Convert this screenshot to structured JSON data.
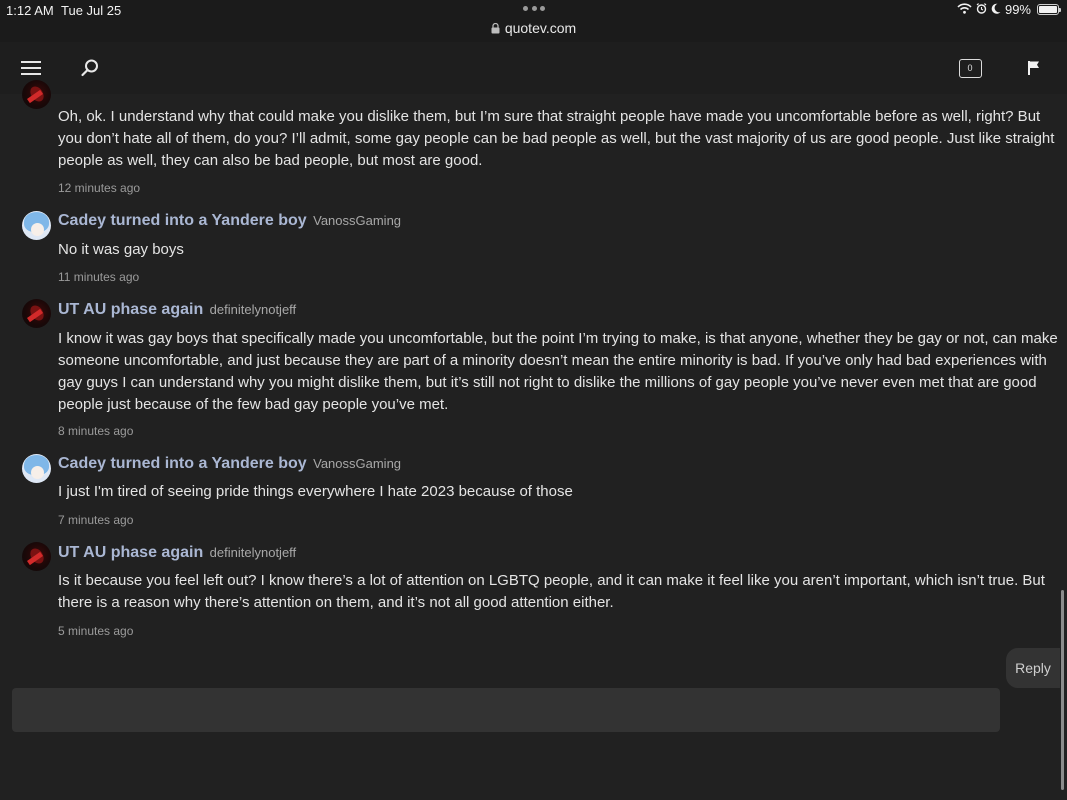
{
  "status_bar": {
    "time": "1:12 AM",
    "date": "Tue Jul 25",
    "url": "quotev.com",
    "battery": "99%",
    "battery_level": 0.99
  },
  "topbar": {
    "notification_count": "0"
  },
  "comments": [
    {
      "author": "",
      "username": "",
      "avatar": "ut-avatar",
      "text": "Oh, ok. I understand why that could make you dislike them, but I’m sure that straight people have made you uncomfortable before as well, right? But you don’t hate all of them, do you? I’ll admit, some gay people can be bad people as well, but the vast majority of us are good people. Just like straight people as well, they can also be bad people, but most are good.",
      "time": "12 minutes ago"
    },
    {
      "author": "Cadey turned into a Yandere boy",
      "username": "VanossGaming",
      "avatar": "cadey-avatar",
      "text": "No it was gay boys",
      "time": "11 minutes ago"
    },
    {
      "author": "UT AU phase again",
      "username": "definitelynotjeff",
      "avatar": "ut-avatar",
      "text": "I know it was gay boys that specifically made you uncomfortable, but the point I’m trying to make, is that anyone, whether they be gay or not, can make someone uncomfortable, and just because they are part of a minority doesn’t mean the entire minority is bad. If you’ve only had bad experiences with gay guys I can understand why you might dislike them, but it’s still not right to dislike the millions of gay people you’ve never even met that are good people just because of the few bad gay people you’ve met.",
      "time": "8 minutes ago"
    },
    {
      "author": "Cadey turned into a Yandere boy",
      "username": "VanossGaming",
      "avatar": "cadey-avatar",
      "text": "I just I'm tired of seeing pride things everywhere I hate 2023 because of those",
      "time": "7 minutes ago"
    },
    {
      "author": "UT AU phase again",
      "username": "definitelynotjeff",
      "avatar": "ut-avatar",
      "text": "Is it because you feel left out? I know there’s a lot of attention on LGBTQ people, and it can make it feel like you aren’t important, which isn’t true. But there is a reason why there’s attention on them, and it’s not all good attention either.",
      "time": "5 minutes ago"
    }
  ],
  "reply": {
    "button_label": "Reply",
    "input_value": "",
    "placeholder": ""
  },
  "icons": {
    "menu": "hamburger-menu-icon",
    "search": "search-icon",
    "notifications": "notification-box-icon",
    "flag": "flag-icon",
    "lock": "lock-icon",
    "wifi": "wifi-icon",
    "alarm": "alarm-icon",
    "moon": "moon-icon",
    "battery": "battery-icon"
  },
  "colors": {
    "background": "#212121",
    "author": "#aab7d3",
    "text": "#e4e4e4",
    "muted": "#9b9b9b"
  }
}
